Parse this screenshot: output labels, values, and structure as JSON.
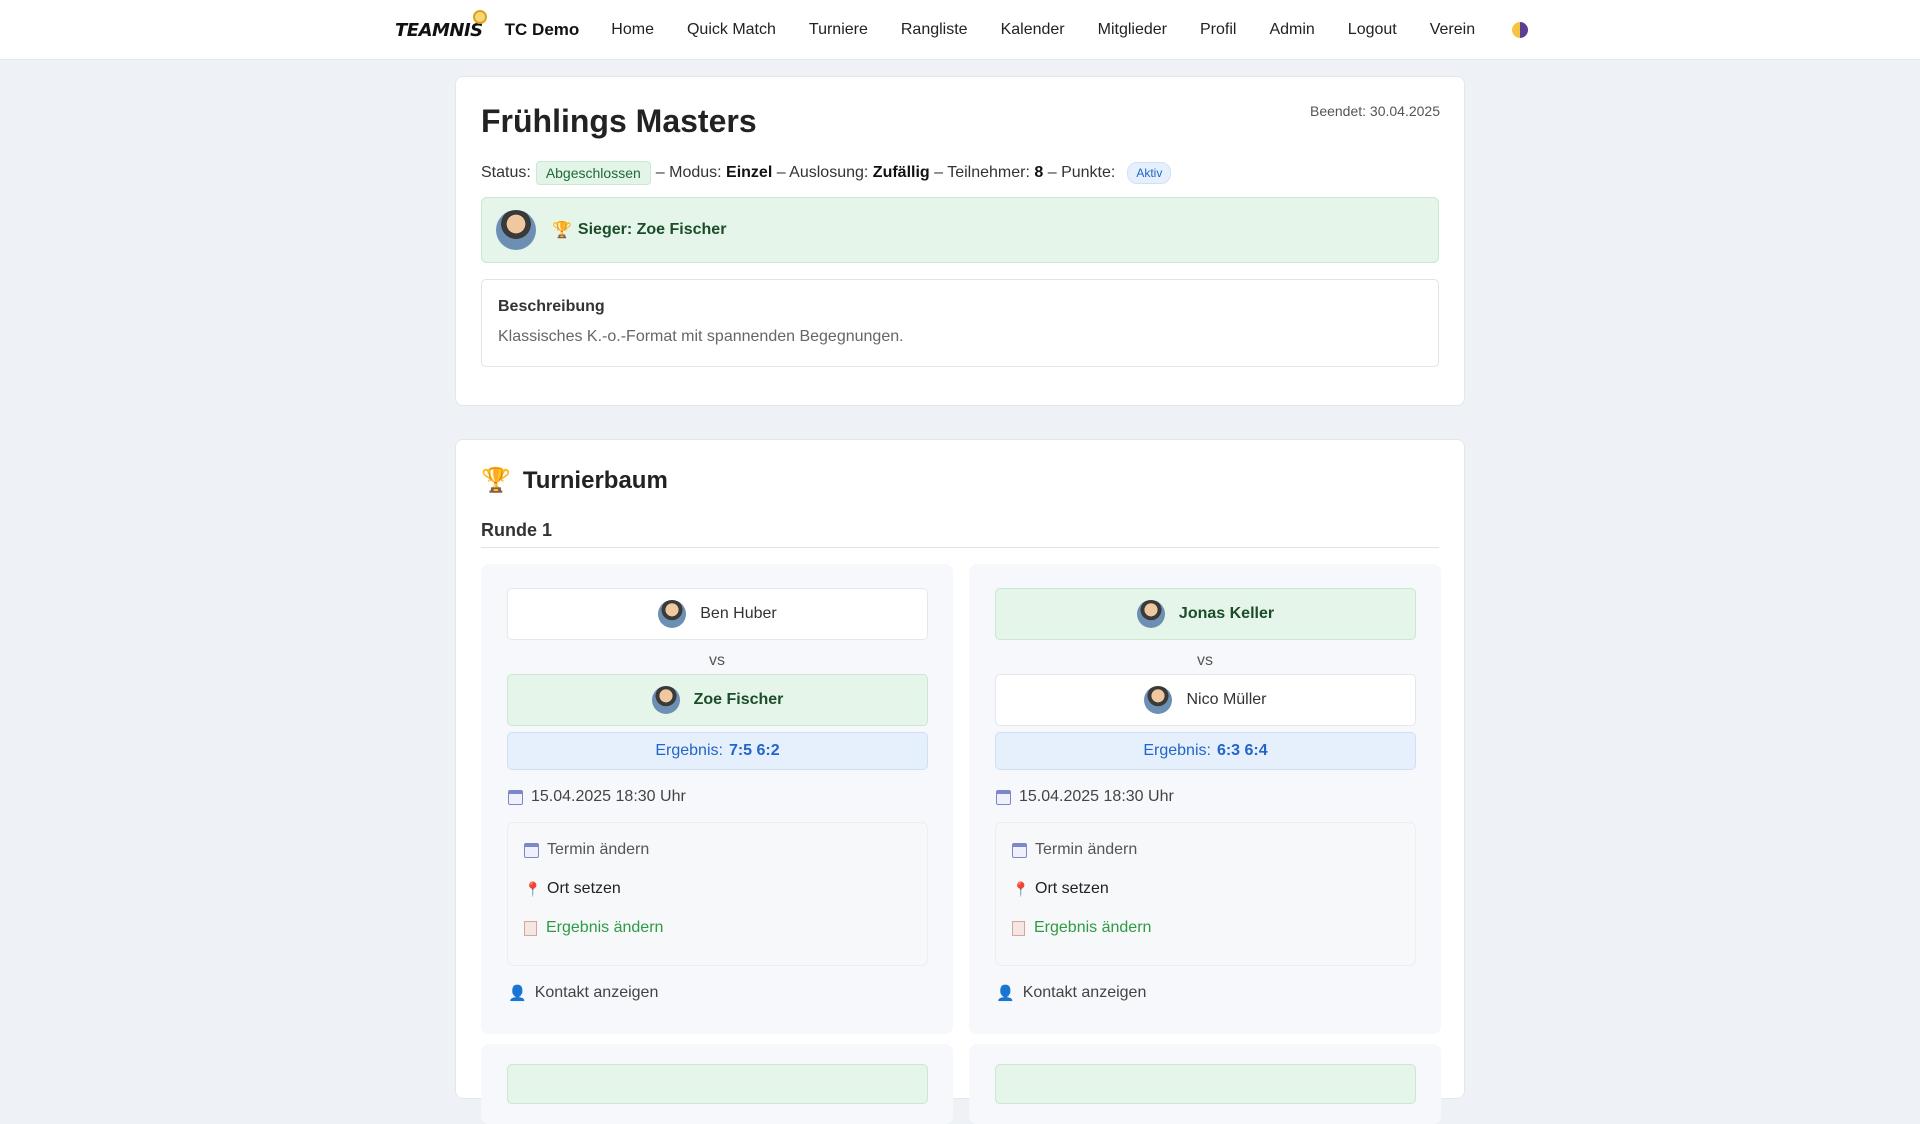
{
  "nav": {
    "logo": "TEAMNIS",
    "brand": "TC Demo",
    "links": [
      "Home",
      "Quick Match",
      "Turniere",
      "Rangliste",
      "Kalender",
      "Mitglieder",
      "Profil",
      "Admin",
      "Logout",
      "Verein"
    ]
  },
  "tournament": {
    "title": "Frühlings Masters",
    "ended": "Beendet: 30.04.2025",
    "status_label": "Status:",
    "status": "Abgeschlossen",
    "mode_label": "– Modus:",
    "mode": "Einzel",
    "draw_label": "– Auslosung:",
    "draw": "Zufällig",
    "participants_label": "– Teilnehmer:",
    "participants": "8",
    "points_label": "– Punkte:",
    "points": "Aktiv",
    "winner": "Sieger: Zoe Fischer",
    "description_title": "Beschreibung",
    "description": "Klassisches K.-o.-Format mit spannenden Begegnungen."
  },
  "bracket": {
    "title": "Turnierbaum",
    "round": "Runde 1",
    "vs": "vs",
    "result_label": "Ergebnis:",
    "actions": {
      "termin": "Termin ändern",
      "ort": "Ort setzen",
      "ergebnis": "Ergebnis ändern",
      "kontakt": "Kontakt anzeigen"
    },
    "matches": [
      {
        "p1": "Ben Huber",
        "p2": "Zoe Fischer",
        "score": "7:5 6:2",
        "date": "15.04.2025 18:30 Uhr",
        "winner": "p2"
      },
      {
        "p1": "Jonas Keller",
        "p2": "Nico Müller",
        "score": "6:3 6:4",
        "date": "15.04.2025 18:30 Uhr",
        "winner": "p1"
      }
    ]
  },
  "colors": {
    "winner_bg": "#e6f5ea",
    "result_blue": "#2165c8",
    "action_green": "#2e9a44"
  }
}
